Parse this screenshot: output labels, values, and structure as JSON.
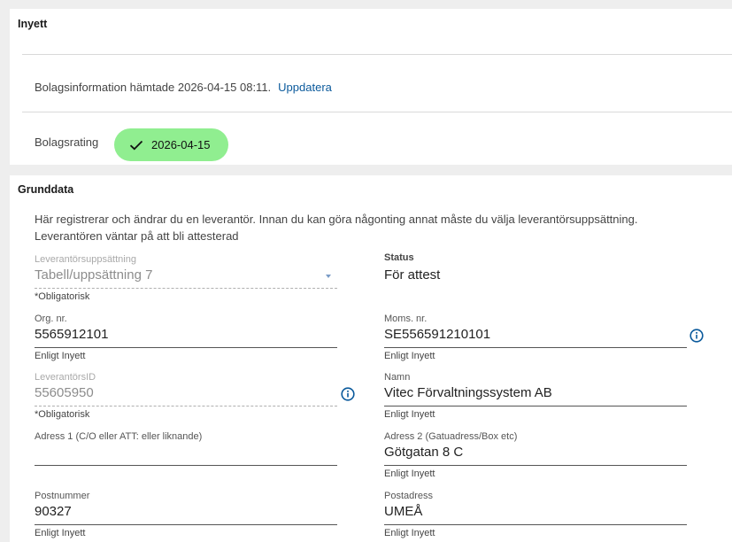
{
  "inyett": {
    "title": "Inyett",
    "info_text": "Bolagsinformation hämtade 2026-04-15 08:11.",
    "update_link": "Uppdatera",
    "rating_label": "Bolagsrating",
    "rating_date": "2026-04-15",
    "rating_color": "#90ee90"
  },
  "grunddata": {
    "title": "Grunddata",
    "intro_line1": "Här registrerar och ändrar du en leverantör. Innan du kan göra någonting annat måste du välja leverantörsuppsättning.",
    "intro_line2": "Leverantören väntar på att bli attesterad",
    "fields": {
      "supplier_set": {
        "label": "Leverantörsuppsättning",
        "value": "Tabell/uppsättning 7",
        "hint": "*Obligatorisk"
      },
      "status": {
        "label": "Status",
        "value": "För attest"
      },
      "org_nr": {
        "label": "Org. nr.",
        "value": "5565912101",
        "hint": "Enligt Inyett"
      },
      "moms_nr": {
        "label": "Moms. nr.",
        "value": "SE556591210101",
        "hint": "Enligt Inyett"
      },
      "supplier_id": {
        "label": "LeverantörsID",
        "value": "55605950",
        "hint": "*Obligatorisk"
      },
      "name": {
        "label": "Namn",
        "value": "Vitec Förvaltningssystem AB",
        "hint": "Enligt Inyett"
      },
      "address1": {
        "label": "Adress 1 (C/O eller ATT: eller liknande)",
        "value": ""
      },
      "address2": {
        "label": "Adress 2 (Gatuadress/Box etc)",
        "value": "Götgatan 8 C",
        "hint": "Enligt Inyett"
      },
      "postnummer": {
        "label": "Postnummer",
        "value": "90327",
        "hint": "Enligt Inyett"
      },
      "postadress": {
        "label": "Postadress",
        "value": "UMEÅ",
        "hint": "Enligt Inyett"
      }
    }
  },
  "colors": {
    "link": "#0b5a9c",
    "info_icon": "#0b5a9c"
  }
}
